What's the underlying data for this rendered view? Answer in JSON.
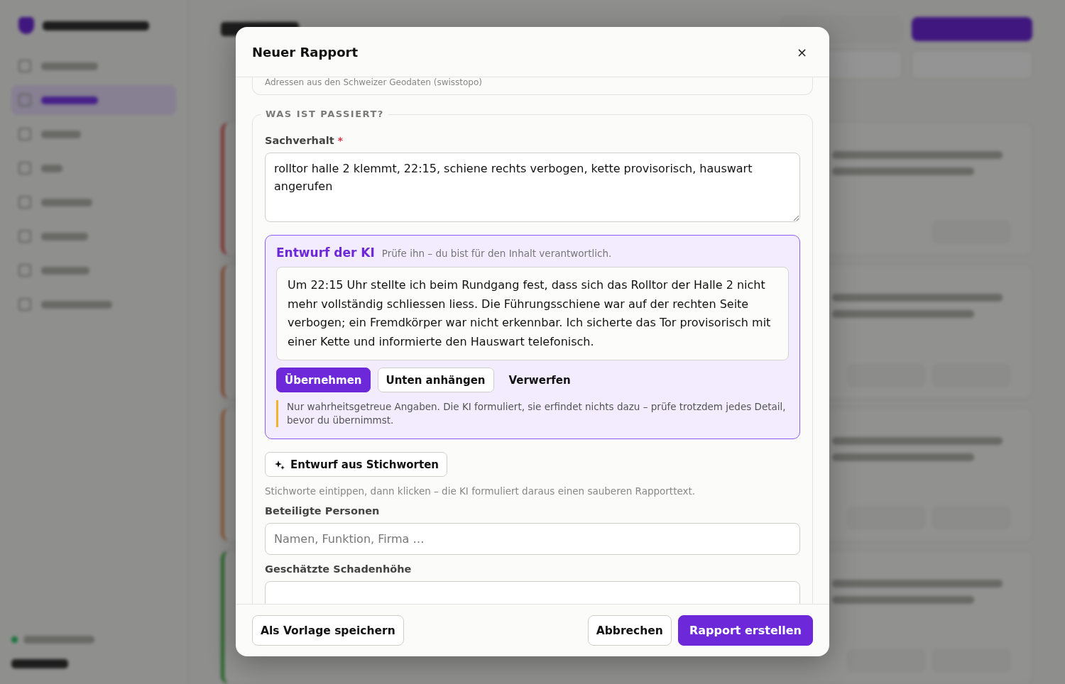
{
  "dialog": {
    "title": "Neuer Rapport",
    "close": "×",
    "address_hint": "Adressen aus den Schweizer Geodaten (swisstopo)",
    "section": {
      "legend": "WAS IST PASSIERT?",
      "facts": {
        "label": "Sachverhalt",
        "required_mark": "*",
        "value": "rolltor halle 2 klemmt, 22:15, schiene rechts verbogen, kette provisorisch, hauswart angerufen"
      },
      "ai_draft": {
        "title": "Entwurf der KI",
        "subtitle": "Prüfe ihn – du bist für den Inhalt verantwortlich.",
        "text": "Um 22:15 Uhr stellte ich beim Rundgang fest, dass sich das Rolltor der Halle 2 nicht mehr vollständig schliessen liess. Die Führungsschiene war auf der rechten Seite verbogen; ein Fremdkörper war nicht erkennbar. Ich sicherte das Tor provisorisch mit einer Kette und informierte den Hauswart telefonisch.",
        "buttons": [
          {
            "label": "Übernehmen",
            "kind": "primary"
          },
          {
            "label": "Unten anhängen",
            "kind": "secondary"
          },
          {
            "label": "Verwerfen",
            "kind": "plain"
          }
        ],
        "note": "Nur wahrheitsgetreue Angaben. Die KI formuliert, sie erfindet nichts dazu – prüfe trotzdem jedes Detail, bevor du übernimmst."
      },
      "draft_button": "Entwurf aus Stichworten",
      "draft_hint": "Stichworte eintippen, dann klicken – die KI formuliert daraus einen sauberen Rapporttext.",
      "fields": [
        {
          "label": "Beteiligte Personen",
          "placeholder": "Namen, Funktion, Firma …"
        },
        {
          "label": "Geschätzte Schadenhöhe"
        }
      ]
    },
    "footer": {
      "left": "Als Vorlage speichern",
      "cancel": "Abbrechen",
      "submit": "Rapport erstellen"
    }
  }
}
